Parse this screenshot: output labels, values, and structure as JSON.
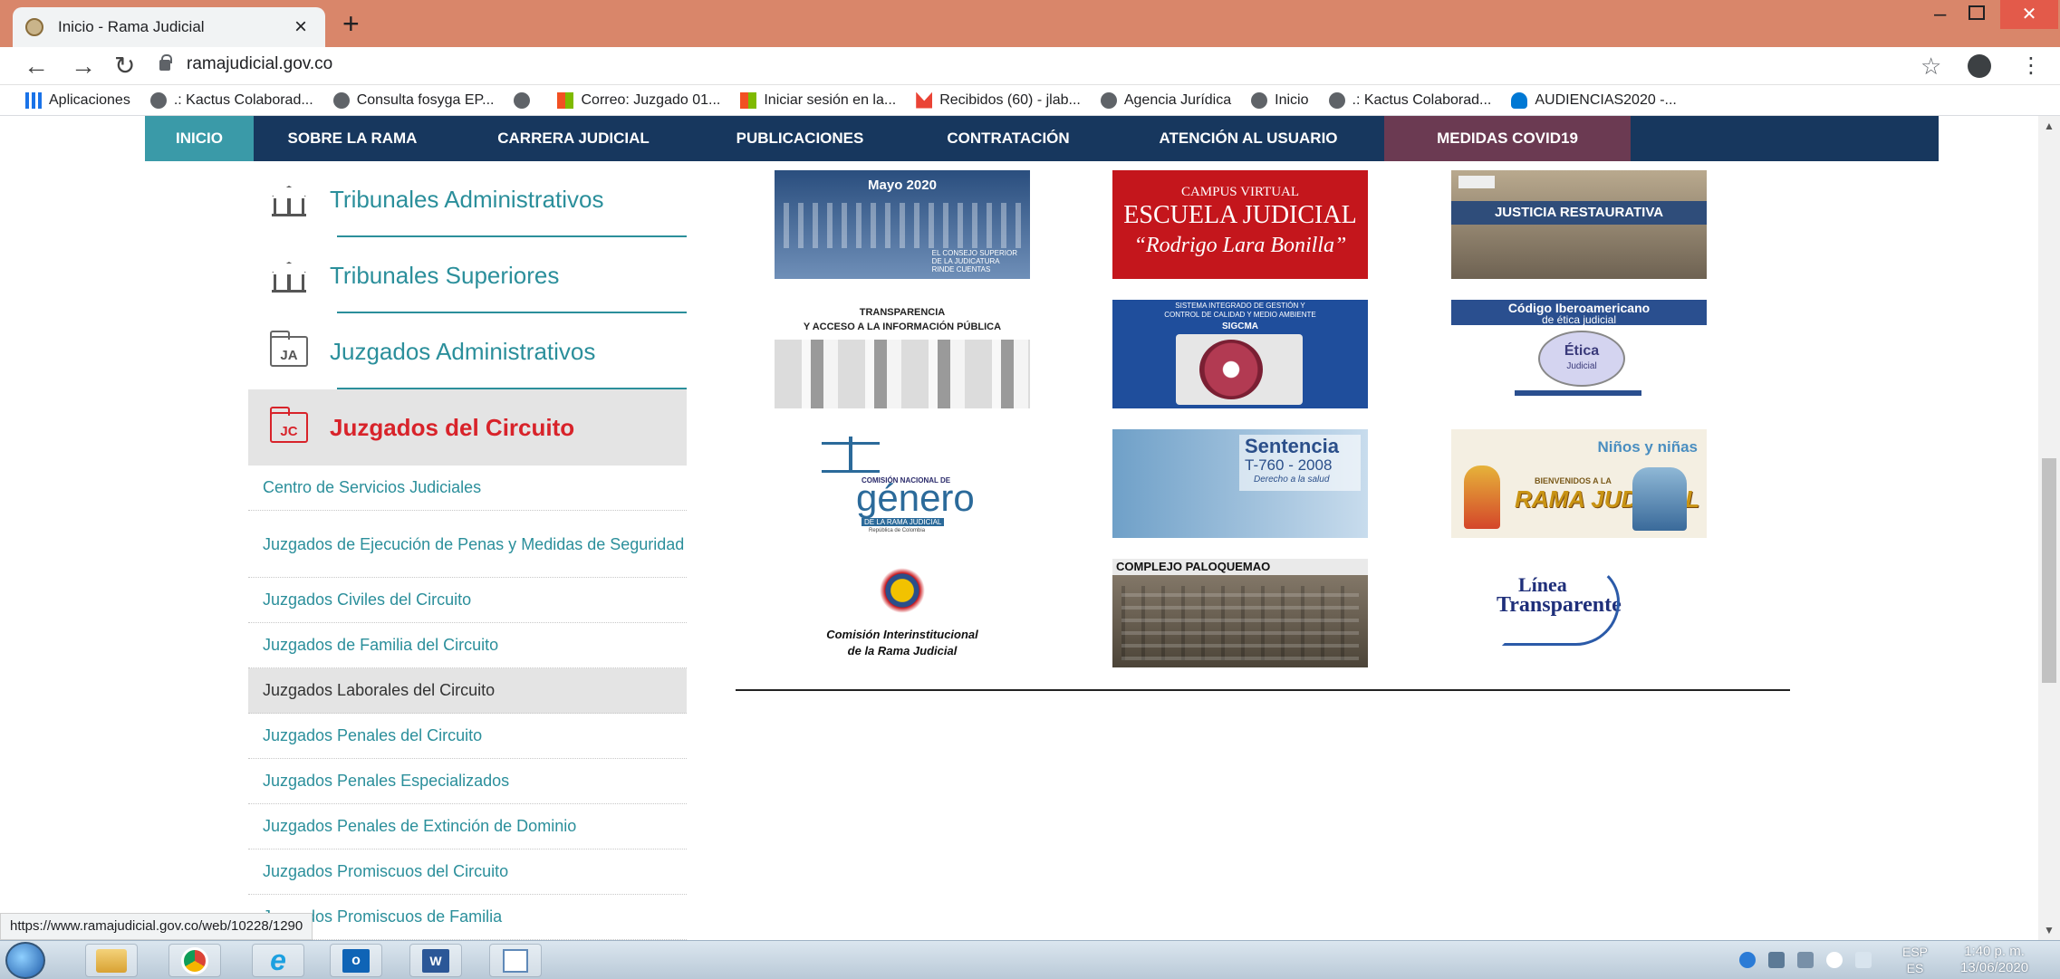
{
  "browser": {
    "tab_title": "Inicio - Rama Judicial",
    "url": "ramajudicial.gov.co",
    "bookmarks": [
      "Aplicaciones",
      ".: Kactus Colaborad...",
      "Consulta fosyga EP...",
      "",
      "Correo: Juzgado 01...",
      "Iniciar sesión en la...",
      "Recibidos (60) - jlab...",
      "Agencia Jurídica",
      "Inicio",
      ".: Kactus Colaborad...",
      "AUDIENCIAS2020 -..."
    ],
    "status_url": "https://www.ramajudicial.gov.co/web/10228/1290"
  },
  "nav": [
    {
      "label": "INICIO",
      "color": "#3a9aa8"
    },
    {
      "label": "SOBRE LA RAMA",
      "color": "#17375e"
    },
    {
      "label": "CARRERA JUDICIAL",
      "color": "#17375e"
    },
    {
      "label": "PUBLICACIONES",
      "color": "#17375e"
    },
    {
      "label": "CONTRATACIÓN",
      "color": "#17375e"
    },
    {
      "label": "ATENCIÓN AL USUARIO",
      "color": "#17375e"
    },
    {
      "label": "MEDIDAS COVID19",
      "color": "#6b3a52"
    }
  ],
  "sidebar": {
    "main": [
      {
        "label": "Tribunales Administrativos",
        "icon": "courthouse-icon"
      },
      {
        "label": "Tribunales Superiores",
        "icon": "courthouse-icon"
      },
      {
        "label": "Juzgados Administrativos",
        "icon": "folder-ja-icon",
        "badge": "JA"
      },
      {
        "label": "Juzgados del Circuito",
        "icon": "folder-jc-icon",
        "badge": "JC",
        "active": true
      }
    ],
    "sub": [
      "Centro de Servicios Judiciales",
      "Juzgados de Ejecución de Penas y Medidas de Seguridad",
      "Juzgados Civiles del Circuito",
      "Juzgados de Familia del Circuito",
      "Juzgados Laborales del Circuito",
      "Juzgados Penales del Circuito",
      "Juzgados Penales Especializados",
      "Juzgados Penales de Extinción de Dominio",
      "Juzgados Promiscuos del Circuito",
      "Juzgados Promiscuos de Familia"
    ]
  },
  "banners": {
    "mayo": {
      "title": "Mayo 2020",
      "sub1": "EL CONSEJO SUPERIOR",
      "sub2": "DE LA JUDICATURA",
      "sub3": "RINDE CUENTAS"
    },
    "campus": {
      "l1": "CAMPUS VIRTUAL",
      "l2": "ESCUELA JUDICIAL",
      "l3": "“Rodrigo Lara Bonilla”"
    },
    "justicia": {
      "l1": "JUSTICIA RESTAURATIVA"
    },
    "transparencia": {
      "l1": "TRANSPARENCIA",
      "l2": "Y ACCESO A LA INFORMACIÓN PÚBLICA"
    },
    "sigcma": {
      "l1": "SISTEMA INTEGRADO DE GESTIÓN Y",
      "l2": "CONTROL DE CALIDAD Y MEDIO AMBIENTE",
      "l3": "SIGCMA"
    },
    "codigo": {
      "l1": "Código Iberoamericano",
      "l2": "de ética judicial",
      "badge1": "Ética",
      "badge2": "Judicial"
    },
    "genero": {
      "l1": "COMISIÓN NACIONAL DE",
      "l2": "género",
      "l3": "DE LA RAMA JUDICIAL",
      "l4": "República de Colombia"
    },
    "sentencia": {
      "l1": "Sentencia",
      "l2": "T-760 - 2008",
      "l3": "Derecho a la salud"
    },
    "ninos": {
      "l1": "Niños y niñas",
      "l2": "BIENVENIDOS A LA",
      "l3": "RAMA JUDICIAL"
    },
    "comision": {
      "l1": "Comisión Interinstitucional",
      "l2": "de la Rama Judicial"
    },
    "paloquemao": {
      "l1": "COMPLEJO PALOQUEMAO"
    },
    "linea": {
      "l1": "Línea",
      "l2": "Transparente"
    }
  },
  "taskbar": {
    "lang_top": "ESP",
    "lang_bottom": "ES",
    "time": "1:40 p. m.",
    "date": "13/06/2020"
  },
  "colors": {
    "nav_bg": "#17375e",
    "teal": "#2b8f9b",
    "active_red": "#d8232a",
    "tab_strip": "#d9866a"
  }
}
